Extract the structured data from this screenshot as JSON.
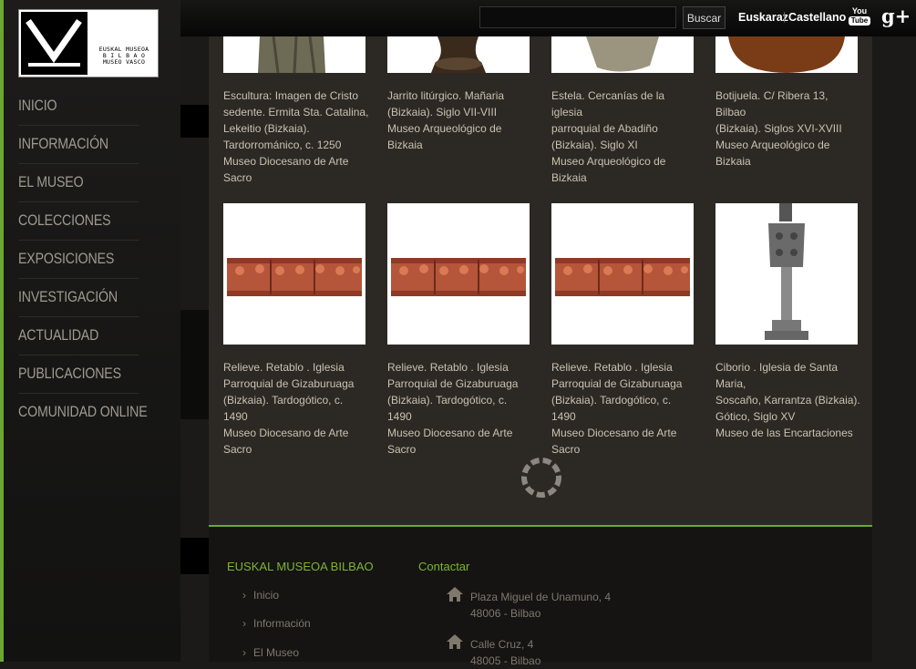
{
  "logo": {
    "line1": "EUSKAL MUSEOA",
    "line2": "B I L B A O",
    "line3": "MUSEO VASCO"
  },
  "nav": [
    "INICIO",
    "INFORMACIÓN",
    "EL MUSEO",
    "COLECCIONES",
    "EXPOSICIONES",
    "INVESTIGACIÓN",
    "ACTUALIDAD",
    "PUBLICACIONES",
    "COMUNIDAD ONLINE"
  ],
  "topbar": {
    "search_placeholder": "",
    "search_button": "Buscar",
    "lang_eu": "Euskaraz",
    "lang_sep": "|",
    "lang_es": "Castellano",
    "youtube_you": "You",
    "youtube_tube": "Tube",
    "gplus": "g+"
  },
  "row1": [
    {
      "lines": [
        "Escultura: Imagen de Cristo",
        "sedente. Ermita Sta. Catalina,",
        "Lekeitio (Bizkaia).",
        "Tardorrománico, c. 1250",
        "Museo Diocesano de Arte",
        "Sacro"
      ]
    },
    {
      "lines": [
        "Jarrito litúrgico. Mañaria",
        "(Bizkaia). Siglo VII-VIII",
        "Museo Arqueológico de Bizkaia"
      ]
    },
    {
      "lines": [
        "Estela. Cercanías de la iglesia",
        "parroquial de Abadiño",
        "(Bizkaia). Siglo XI",
        "Museo Arqueológico de Bizkaia"
      ]
    },
    {
      "lines": [
        "Botijuela. C/ Ribera 13, Bilbao",
        "(Bizkaia). Siglos XVI-XVIII",
        "Museo Arqueológico de Bizkaia"
      ]
    }
  ],
  "row2": [
    {
      "lines": [
        "Relieve. Retablo . Iglesia",
        "Parroquial de Gizaburuaga",
        "(Bizkaia). Tardogótico, c. 1490",
        "Museo Diocesano de Arte",
        "Sacro"
      ]
    },
    {
      "lines": [
        "Relieve. Retablo . Iglesia",
        "Parroquial de Gizaburuaga",
        "(Bizkaia). Tardogótico, c. 1490",
        "Museo Diocesano de Arte",
        "Sacro"
      ]
    },
    {
      "lines": [
        "Relieve. Retablo . Iglesia",
        "Parroquial de Gizaburuaga",
        "(Bizkaia). Tardogótico, c. 1490",
        "Museo Diocesano de Arte",
        "Sacro"
      ]
    },
    {
      "lines": [
        "Ciborio . Iglesia de Santa Maria,",
        "Soscaño, Karrantza (Bizkaia).",
        "Gótico, Siglo XV",
        "Museo de las Encartaciones"
      ]
    }
  ],
  "footer": {
    "col1_title": "EUSKAL MUSEOA BILBAO",
    "col1_links": [
      "Inicio",
      "Información",
      "El Museo"
    ],
    "col2_title": "Contactar",
    "addresses": [
      [
        "Plaza Miguel de Unamuno, 4",
        "48006 - Bilbao"
      ],
      [
        "Calle Cruz, 4",
        "48005 - Bilbao"
      ]
    ]
  },
  "colors": {
    "accent_green": "#6aa82f",
    "panel": "#2c2925",
    "caption": "#c9c1b1"
  }
}
